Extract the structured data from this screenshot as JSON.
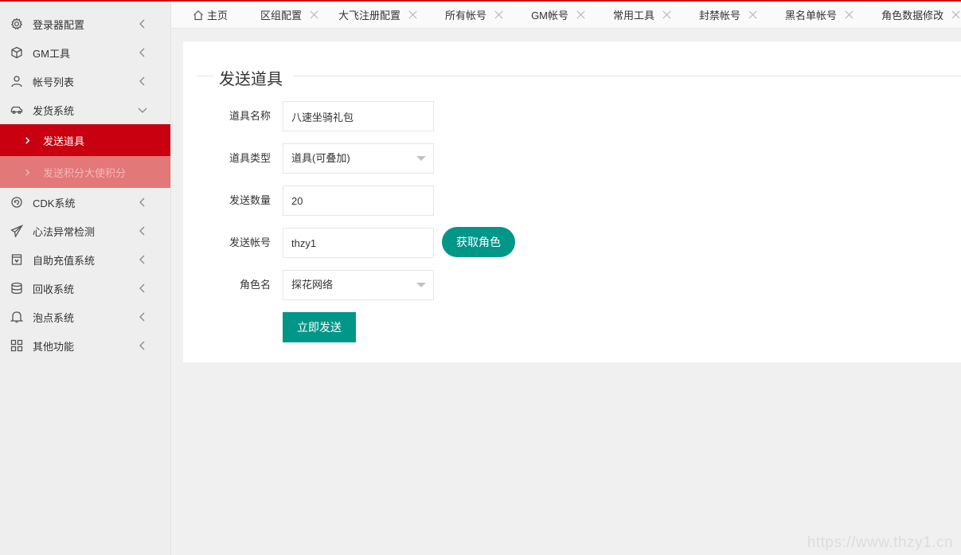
{
  "sidebar": {
    "items": [
      {
        "label": "登录器配置",
        "icon": "gear-icon"
      },
      {
        "label": "GM工具",
        "icon": "cube-icon"
      },
      {
        "label": "帐号列表",
        "icon": "user-icon"
      },
      {
        "label": "发货系统",
        "icon": "car-icon",
        "expanded": true,
        "children": [
          {
            "label": "发送道具",
            "active": true
          },
          {
            "label": "发送积分大使积分"
          }
        ]
      },
      {
        "label": "CDK系统",
        "icon": "refresh-icon"
      },
      {
        "label": "心法异常检测",
        "icon": "paper-plane-icon"
      },
      {
        "label": "自助充值系统",
        "icon": "shop-icon"
      },
      {
        "label": "回收系统",
        "icon": "database-icon"
      },
      {
        "label": "泡点系统",
        "icon": "bell-icon"
      },
      {
        "label": "其他功能",
        "icon": "apps-icon"
      }
    ]
  },
  "tabs": [
    {
      "label": "主页",
      "icon": "home-icon",
      "closable": false
    },
    {
      "label": "区组配置",
      "closable": true
    },
    {
      "label": "大飞注册配置",
      "closable": true
    },
    {
      "label": "所有帐号",
      "closable": true
    },
    {
      "label": "GM帐号",
      "closable": true
    },
    {
      "label": "常用工具",
      "closable": true
    },
    {
      "label": "封禁帐号",
      "closable": true
    },
    {
      "label": "黑名单帐号",
      "closable": true
    },
    {
      "label": "角色数据修改",
      "closable": true
    }
  ],
  "form": {
    "title": "发送道具",
    "item_name": {
      "label": "道具名称",
      "value": "八速坐骑礼包"
    },
    "item_type": {
      "label": "道具类型",
      "value": "道具(可叠加)"
    },
    "quantity": {
      "label": "发送数量",
      "value": "20"
    },
    "account": {
      "label": "发送帐号",
      "value": "thzy1"
    },
    "get_role_button": "获取角色",
    "role_name": {
      "label": "角色名",
      "value": "探花网络"
    },
    "submit_button": "立即发送"
  },
  "watermark": "https://www.thzy1.cn",
  "colors": {
    "accent_red": "#c90010",
    "teal": "#009688"
  }
}
